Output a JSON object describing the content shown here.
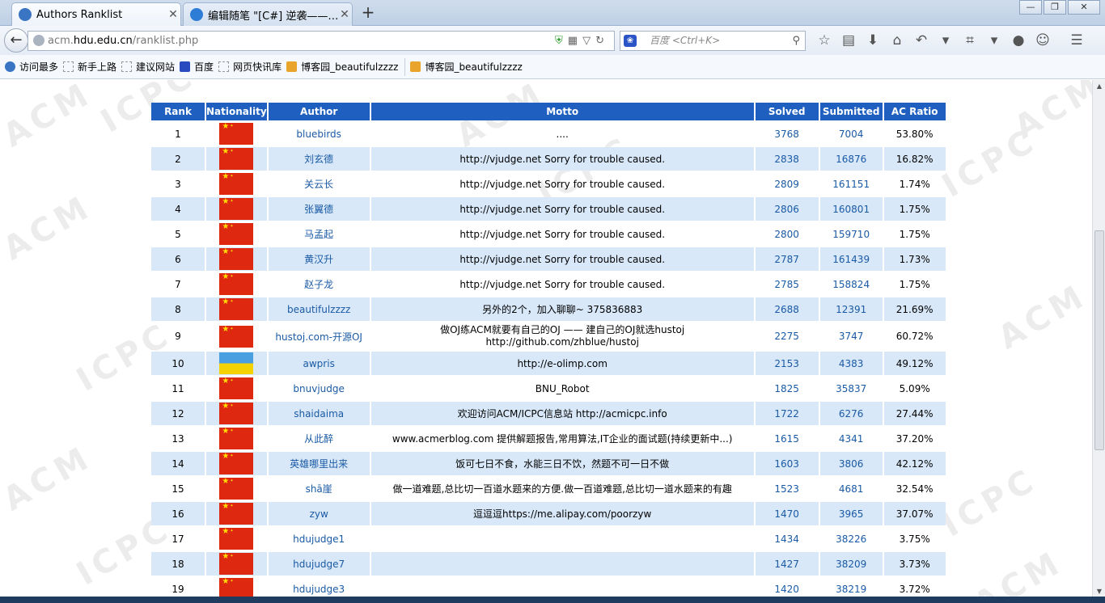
{
  "tabs": [
    {
      "label": "Authors Ranklist",
      "active": true
    },
    {
      "label": "编辑随笔 \"[C#] 逆袭——…",
      "active": false
    }
  ],
  "newtab": "+",
  "window_controls": {
    "minimize": "—",
    "restore": "❐",
    "close": "✕"
  },
  "address": {
    "prefix": "acm.",
    "domain": "hdu.edu.cn",
    "path": "/ranklist.php"
  },
  "search": {
    "engine_icon": "paw-icon",
    "placeholder": "百度 <Ctrl+K>"
  },
  "bookmarks": [
    {
      "label": "访问最多",
      "icon": "ie-icon"
    },
    {
      "label": "新手上路",
      "icon": "page-icon"
    },
    {
      "label": "建议网站",
      "icon": "page-icon"
    },
    {
      "label": "百度",
      "icon": "paw-icon"
    },
    {
      "label": "网页快讯库",
      "icon": "page-icon"
    },
    {
      "label": "博客园_beautifulzzzz",
      "icon": "rss-icon"
    },
    {
      "label": "博客园_beautifulzzzz",
      "icon": "rss-icon"
    }
  ],
  "watermark_text": [
    "ACM",
    "ICPC"
  ],
  "table": {
    "headers": [
      "Rank",
      "Nationality",
      "Author",
      "Motto",
      "Solved",
      "Submitted",
      "AC Ratio"
    ],
    "rows": [
      {
        "rank": "1",
        "flag": "cn",
        "author": "bluebirds",
        "motto": "....",
        "solved": "3768",
        "submitted": "7004",
        "ratio": "53.80%"
      },
      {
        "rank": "2",
        "flag": "cn",
        "author": "刘玄德",
        "motto": "http://vjudge.net Sorry for trouble caused.",
        "solved": "2838",
        "submitted": "16876",
        "ratio": "16.82%"
      },
      {
        "rank": "3",
        "flag": "cn",
        "author": "关云长",
        "motto": "http://vjudge.net Sorry for trouble caused.",
        "solved": "2809",
        "submitted": "161151",
        "ratio": "1.74%"
      },
      {
        "rank": "4",
        "flag": "cn",
        "author": "张翼德",
        "motto": "http://vjudge.net Sorry for trouble caused.",
        "solved": "2806",
        "submitted": "160801",
        "ratio": "1.75%"
      },
      {
        "rank": "5",
        "flag": "cn",
        "author": "马孟起",
        "motto": "http://vjudge.net Sorry for trouble caused.",
        "solved": "2800",
        "submitted": "159710",
        "ratio": "1.75%"
      },
      {
        "rank": "6",
        "flag": "cn",
        "author": "黄汉升",
        "motto": "http://vjudge.net Sorry for trouble caused.",
        "solved": "2787",
        "submitted": "161439",
        "ratio": "1.73%"
      },
      {
        "rank": "7",
        "flag": "cn",
        "author": "赵子龙",
        "motto": "http://vjudge.net Sorry for trouble caused.",
        "solved": "2785",
        "submitted": "158824",
        "ratio": "1.75%"
      },
      {
        "rank": "8",
        "flag": "cn",
        "author": "beautifulzzzz",
        "motto": "另外的2个，加入聊聊~ 375836883",
        "solved": "2688",
        "submitted": "12391",
        "ratio": "21.69%"
      },
      {
        "rank": "9",
        "flag": "cn",
        "author": "hustoj.com-开源OJ",
        "motto": "做OJ练ACM就要有自己的OJ —— 建自己的OJ就选hustoj http://github.com/zhblue/hustoj",
        "solved": "2275",
        "submitted": "3747",
        "ratio": "60.72%"
      },
      {
        "rank": "10",
        "flag": "ua",
        "author": "awpris",
        "motto": "http://e-olimp.com",
        "solved": "2153",
        "submitted": "4383",
        "ratio": "49.12%"
      },
      {
        "rank": "11",
        "flag": "cn",
        "author": "bnuvjudge",
        "motto": "BNU_Robot",
        "solved": "1825",
        "submitted": "35837",
        "ratio": "5.09%"
      },
      {
        "rank": "12",
        "flag": "cn",
        "author": "shaidaima",
        "motto": "欢迎访问ACM/ICPC信息站 http://acmicpc.info",
        "solved": "1722",
        "submitted": "6276",
        "ratio": "27.44%"
      },
      {
        "rank": "13",
        "flag": "cn",
        "author": "从此醉",
        "motto": "www.acmerblog.com  提供解题报告,常用算法,IT企业的面试题(持续更新中...)",
        "solved": "1615",
        "submitted": "4341",
        "ratio": "37.20%"
      },
      {
        "rank": "14",
        "flag": "cn",
        "author": "英雄哪里出来",
        "motto": "饭可七日不食，水能三日不饮，然题不可一日不做",
        "solved": "1603",
        "submitted": "3806",
        "ratio": "42.12%"
      },
      {
        "rank": "15",
        "flag": "cn",
        "author": "shā崖",
        "motto": "做一道难题,总比切一百道水题来的方便.做一百道难题,总比切一道水题来的有趣",
        "solved": "1523",
        "submitted": "4681",
        "ratio": "32.54%"
      },
      {
        "rank": "16",
        "flag": "cn",
        "author": "zyw",
        "motto": "逗逗逗https://me.alipay.com/poorzyw",
        "solved": "1470",
        "submitted": "3965",
        "ratio": "37.07%"
      },
      {
        "rank": "17",
        "flag": "cn",
        "author": "hdujudge1",
        "motto": "",
        "solved": "1434",
        "submitted": "38226",
        "ratio": "3.75%"
      },
      {
        "rank": "18",
        "flag": "cn",
        "author": "hdujudge7",
        "motto": "",
        "solved": "1427",
        "submitted": "38209",
        "ratio": "3.73%"
      },
      {
        "rank": "19",
        "flag": "cn",
        "author": "hdujudge3",
        "motto": "",
        "solved": "1420",
        "submitted": "38219",
        "ratio": "3.72%"
      }
    ]
  }
}
